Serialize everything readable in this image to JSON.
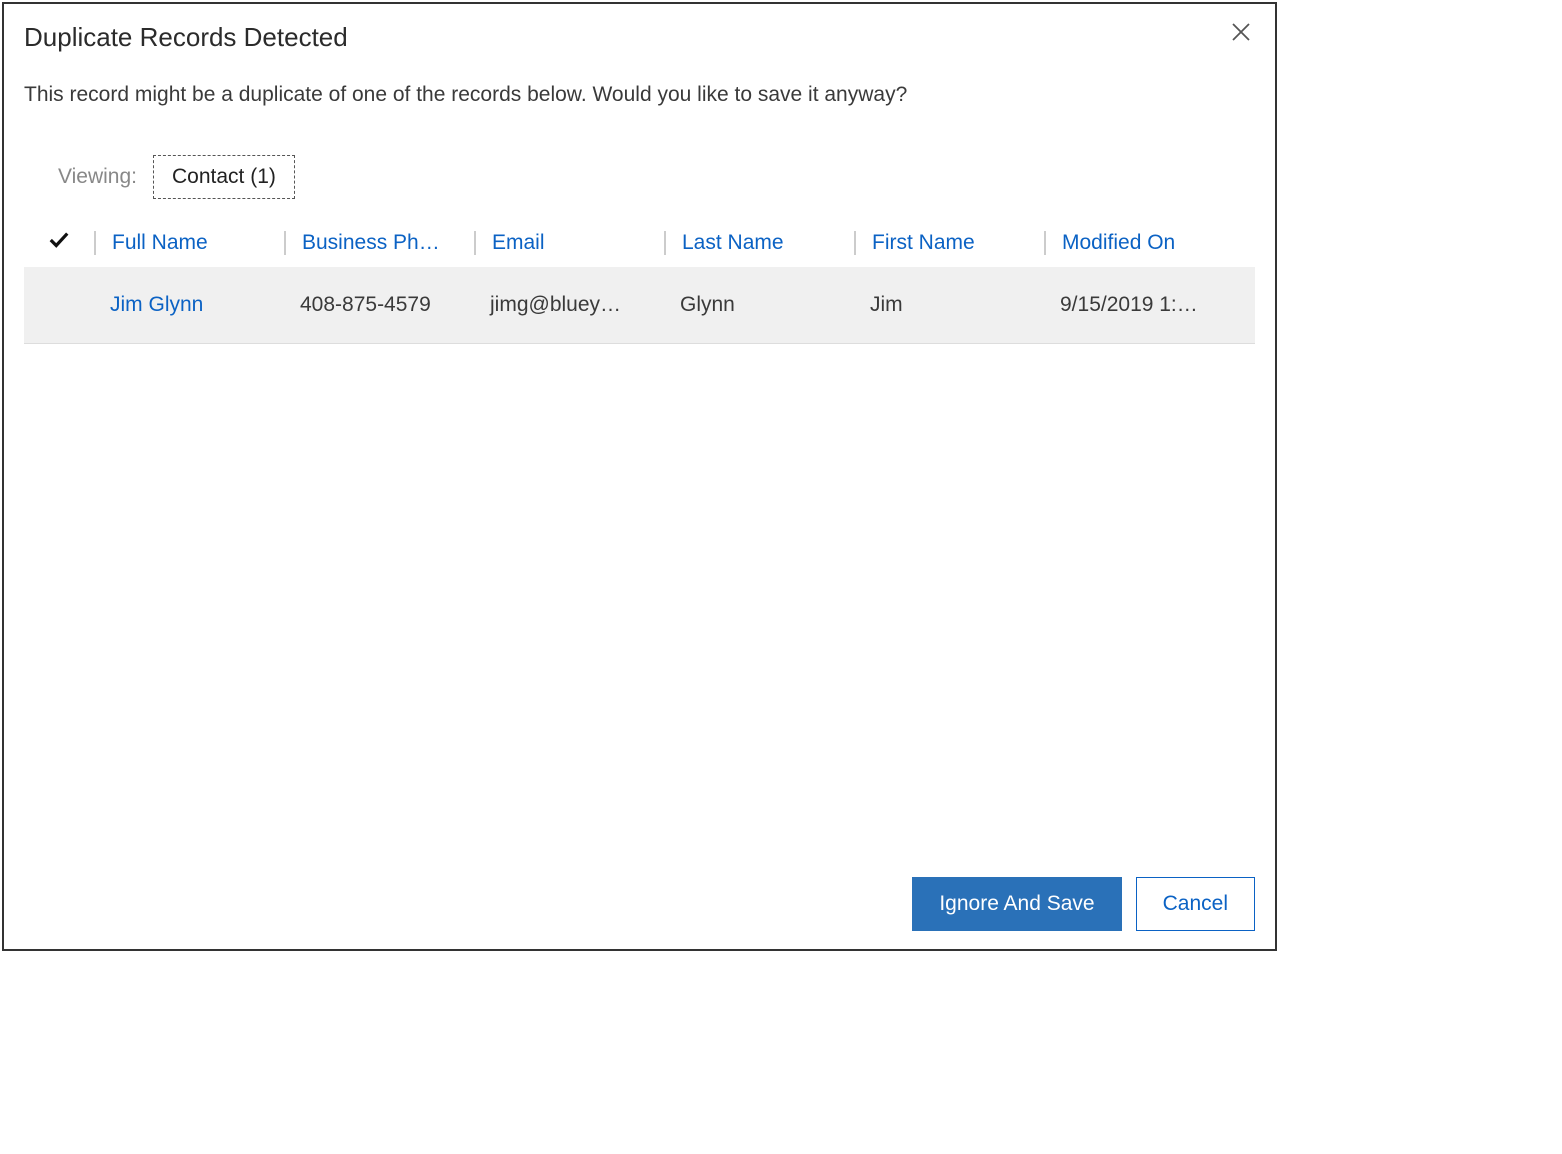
{
  "dialog": {
    "title": "Duplicate Records Detected",
    "message": "This record might be a duplicate of one of the records below. Would you like to save it anyway?"
  },
  "viewing": {
    "label": "Viewing:",
    "tab": "Contact (1)"
  },
  "grid": {
    "columns": {
      "fullname": "Full Name",
      "phone": "Business Ph…",
      "email": "Email",
      "lastname": "Last Name",
      "firstname": "First Name",
      "modified": "Modified On"
    },
    "rows": [
      {
        "fullname": "Jim Glynn",
        "phone": "408-875-4579",
        "email": "jimg@bluey…",
        "lastname": "Glynn",
        "firstname": "Jim",
        "modified": "9/15/2019 1:…"
      }
    ]
  },
  "footer": {
    "primary": "Ignore And Save",
    "secondary": "Cancel"
  }
}
